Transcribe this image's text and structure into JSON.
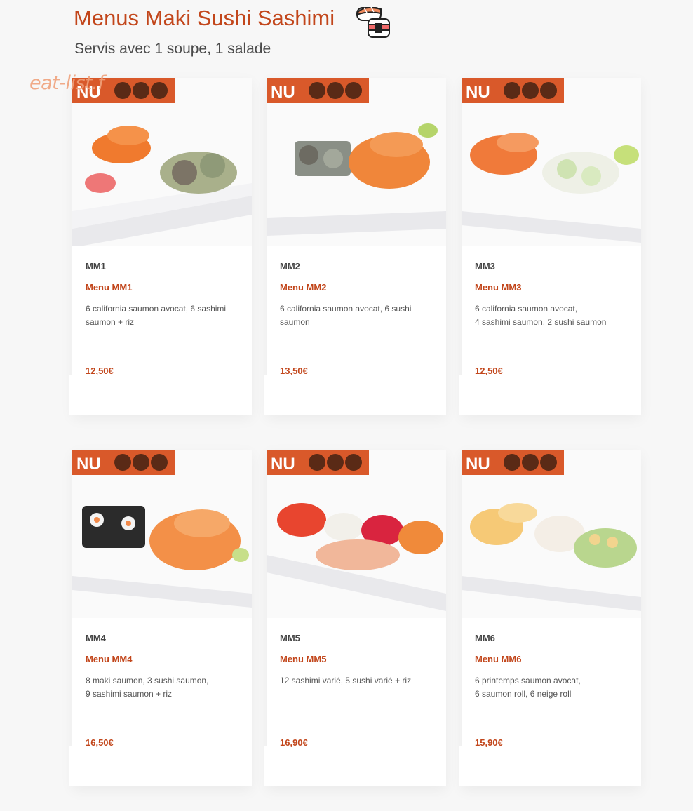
{
  "section": {
    "title": "Menus Maki Sushi Sashimi",
    "subtitle": "Servis avec 1 soupe, 1 salade",
    "title_icon": "sushi-icon"
  },
  "watermark": "eat-list.f",
  "colors": {
    "accent": "#c2461b",
    "text": "#444444"
  },
  "menus": [
    {
      "code": "MM1",
      "name": "Menu MM1",
      "description": "6 california saumon avocat, 6 sashimi\nsaumon + riz",
      "price": "12,50€",
      "photo_label": "NU"
    },
    {
      "code": "MM2",
      "name": "Menu MM2",
      "description": "6 california saumon avocat, 6 sushi\nsaumon",
      "price": "13,50€",
      "photo_label": "NU"
    },
    {
      "code": "MM3",
      "name": "Menu MM3",
      "description": "6 california saumon avocat,\n4 sashimi saumon, 2 sushi saumon",
      "price": "12,50€",
      "photo_label": "NU"
    },
    {
      "code": "MM4",
      "name": "Menu MM4",
      "description": "8 maki saumon, 3 sushi saumon,\n9 sashimi saumon + riz",
      "price": "16,50€",
      "photo_label": "NU"
    },
    {
      "code": "MM5",
      "name": "Menu MM5",
      "description": "12 sashimi varié, 5 sushi varié + riz",
      "price": "16,90€",
      "photo_label": "NU"
    },
    {
      "code": "MM6",
      "name": "Menu MM6",
      "description": "6 printemps saumon avocat,\n6 saumon roll, 6 neige roll",
      "price": "15,90€",
      "photo_label": "NU"
    }
  ]
}
